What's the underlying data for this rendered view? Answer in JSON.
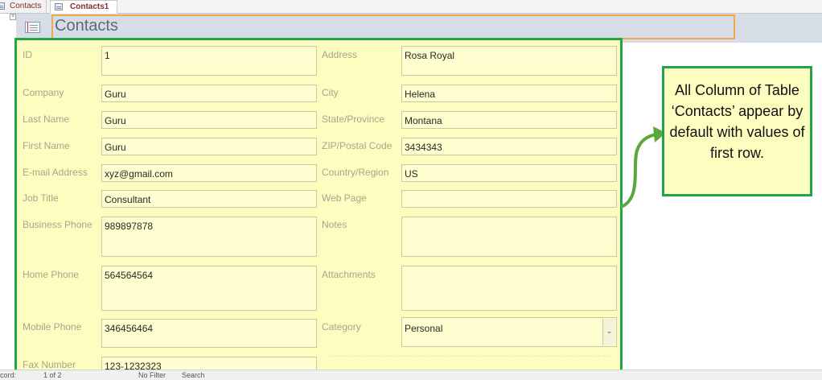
{
  "tabs": [
    {
      "label": "Contacts"
    },
    {
      "label": "Contacts1"
    }
  ],
  "form": {
    "title": "Contacts",
    "fields": {
      "id": {
        "label": "ID",
        "value": "1"
      },
      "company": {
        "label": "Company",
        "value": "Guru"
      },
      "last_name": {
        "label": "Last Name",
        "value": "Guru"
      },
      "first_name": {
        "label": "First Name",
        "value": "Guru"
      },
      "email": {
        "label": "E-mail Address",
        "value": "xyz@gmail.com"
      },
      "job_title": {
        "label": "Job Title",
        "value": "Consultant"
      },
      "business_phone": {
        "label": "Business Phone",
        "value": "989897878"
      },
      "home_phone": {
        "label": "Home Phone",
        "value": "564564564"
      },
      "mobile_phone": {
        "label": "Mobile Phone",
        "value": "346456464"
      },
      "fax_number": {
        "label": "Fax Number",
        "value": "123-1232323"
      },
      "address": {
        "label": "Address",
        "value": "Rosa Royal"
      },
      "city": {
        "label": "City",
        "value": "Helena"
      },
      "state": {
        "label": "State/Province",
        "value": "Montana"
      },
      "zip": {
        "label": "ZIP/Postal Code",
        "value": "3434343"
      },
      "country": {
        "label": "Country/Region",
        "value": "US"
      },
      "web_page": {
        "label": "Web Page",
        "value": ""
      },
      "notes": {
        "label": "Notes",
        "value": ""
      },
      "attachments": {
        "label": "Attachments",
        "value": ""
      },
      "category": {
        "label": "Category",
        "value": "Personal"
      }
    }
  },
  "statusbar": {
    "record_prefix": "cord:",
    "position": "1 of 2",
    "filter": "No Filter",
    "search": "Search"
  },
  "callout": {
    "text": "All Column of Table ‘Contacts’ appear by default with values of first row."
  },
  "colors": {
    "highlight_border": "#1fa64a",
    "form_background": "#fdfdc0",
    "title_box_border": "#f0a848"
  },
  "icons": [
    "form-icon",
    "table-icon",
    "dropdown-arrow-icon",
    "curved-arrow-icon"
  ]
}
